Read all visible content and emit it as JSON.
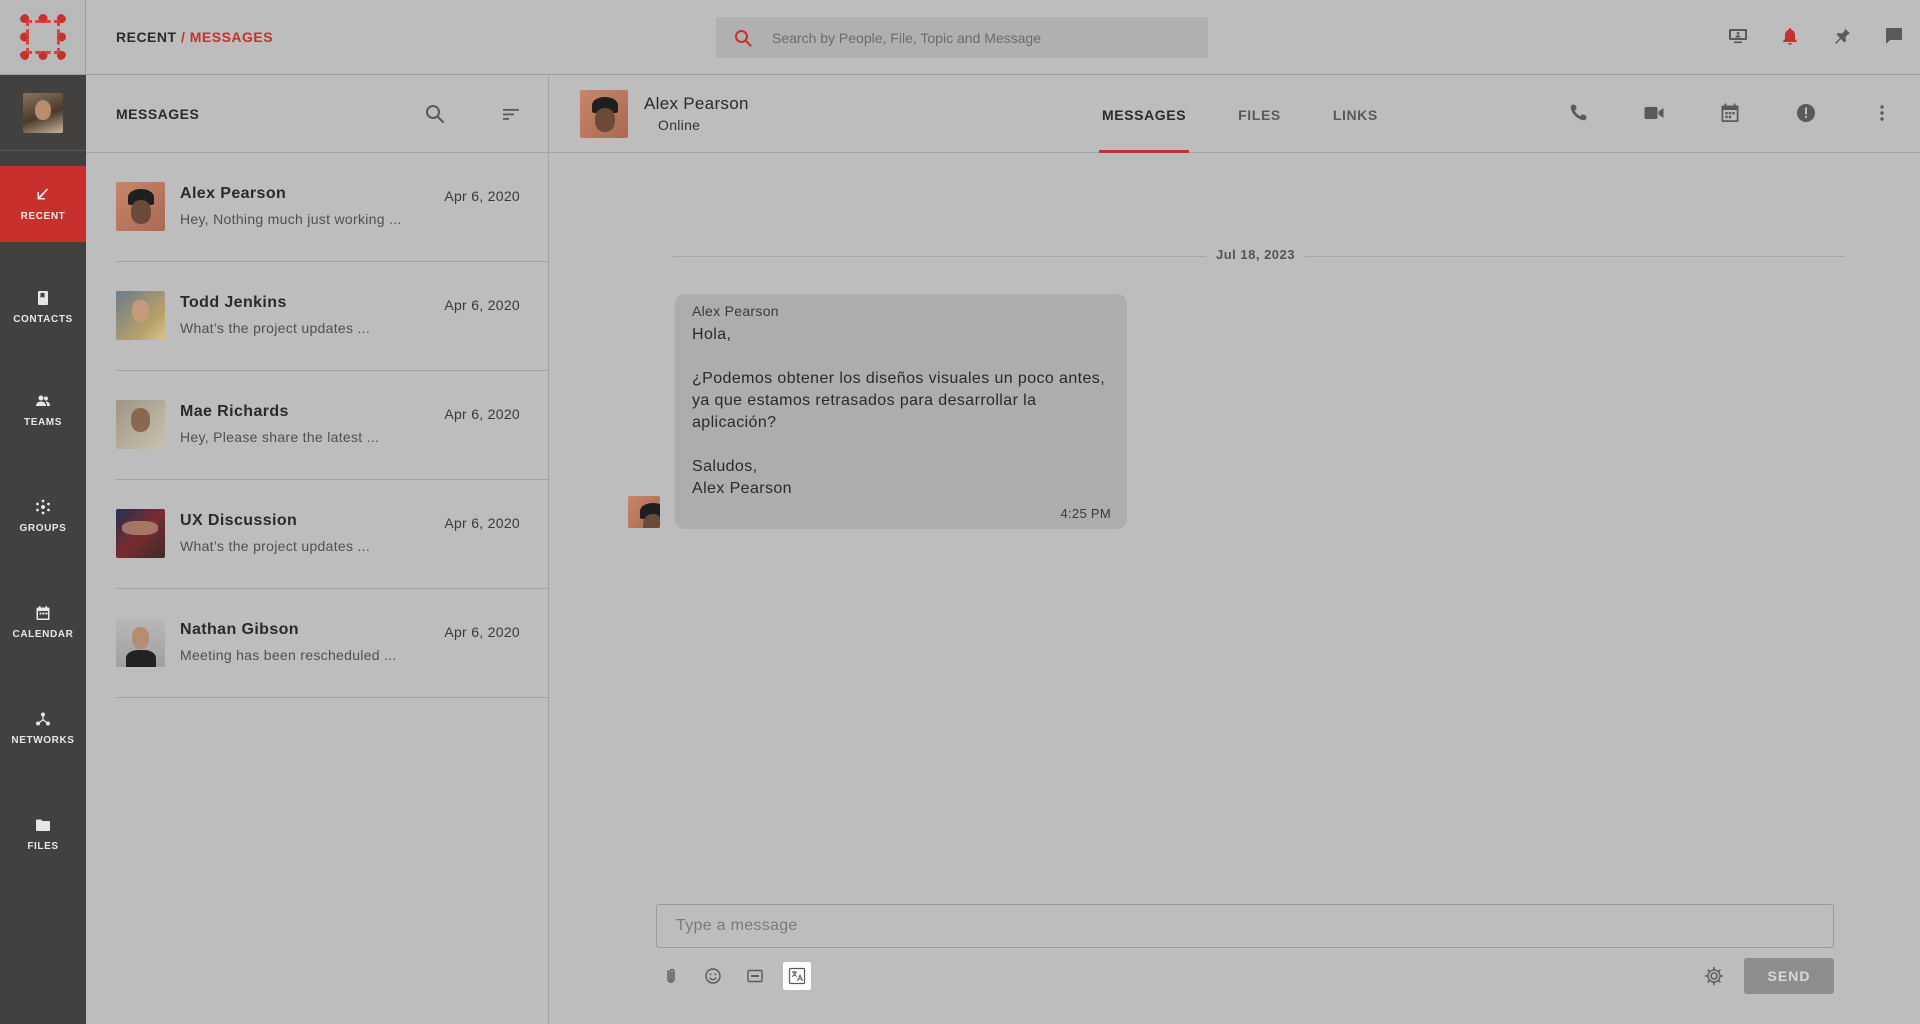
{
  "breadcrumb": {
    "root": "RECENT",
    "separator": "/",
    "current": "MESSAGES"
  },
  "search": {
    "placeholder": "Search by People, File, Topic and Message"
  },
  "colors": {
    "accent": "#c8302d",
    "rail": "#434040",
    "panel": "#bdbdbd"
  },
  "top_icons": [
    "presentation-icon",
    "bell-icon",
    "pin-icon",
    "chat-icon"
  ],
  "rail": {
    "items": [
      {
        "label": "RECENT",
        "icon": "arrow-down-left-icon",
        "active": true
      },
      {
        "label": "CONTACTS",
        "icon": "contact-book-icon"
      },
      {
        "label": "TEAMS",
        "icon": "team-icon"
      },
      {
        "label": "GROUPS",
        "icon": "groups-icon"
      },
      {
        "label": "CALENDAR",
        "icon": "calendar-icon"
      },
      {
        "label": "NETWORKS",
        "icon": "network-icon"
      },
      {
        "label": "FILES",
        "icon": "folder-icon"
      }
    ]
  },
  "list": {
    "title": "MESSAGES",
    "conversations": [
      {
        "name": "Alex Pearson",
        "date": "Apr 6, 2020",
        "preview": "Hey, Nothing much just working ..."
      },
      {
        "name": "Todd Jenkins",
        "date": "Apr 6, 2020",
        "preview": "What’s the project updates ..."
      },
      {
        "name": "Mae Richards",
        "date": "Apr 6, 2020",
        "preview": "Hey, Please share the latest ..."
      },
      {
        "name": "UX Discussion",
        "date": "Apr 6, 2020",
        "preview": "What’s the project updates ..."
      },
      {
        "name": "Nathan Gibson",
        "date": "Apr 6, 2020",
        "preview": "Meeting has been rescheduled ..."
      }
    ]
  },
  "chat": {
    "contact_name": "Alex Pearson",
    "status": "Online",
    "tabs": [
      {
        "label": "MESSAGES",
        "active": true
      },
      {
        "label": "FILES"
      },
      {
        "label": "LINKS"
      }
    ],
    "header_icons": [
      "phone-icon",
      "video-icon",
      "calendar-icon",
      "info-icon",
      "more-vertical-icon"
    ],
    "date_separator": "Jul 18, 2023",
    "message": {
      "from": "Alex Pearson",
      "body": "Hola,\n\n¿Podemos obtener los diseños visuales un poco antes, ya que estamos retrasados para desarrollar la aplicación?\n\nSaludos,\nAlex Pearson",
      "time": "4:25 PM"
    },
    "composer": {
      "placeholder": "Type a message",
      "tools": [
        "attach-icon",
        "emoji-icon",
        "gif-icon",
        "translate-icon"
      ],
      "send_label": "SEND"
    }
  }
}
